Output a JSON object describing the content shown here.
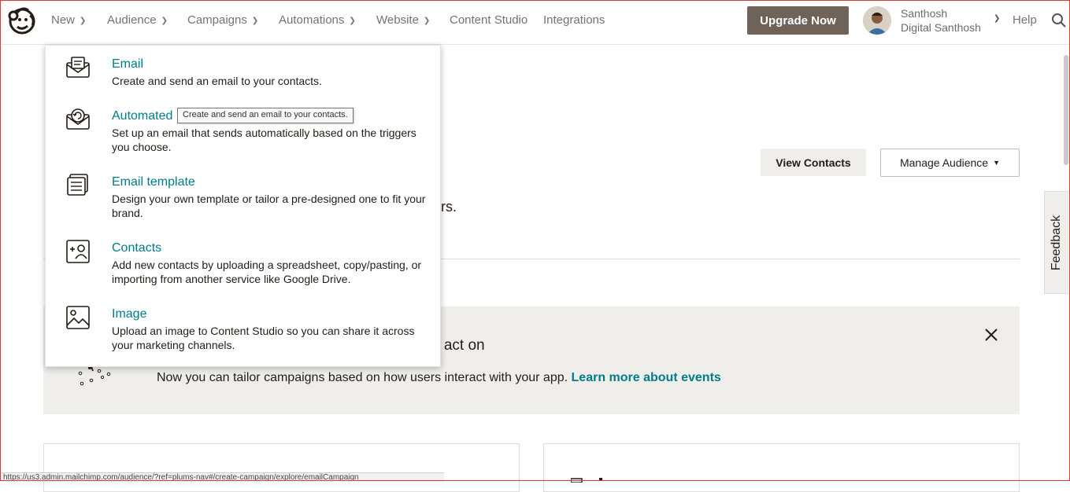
{
  "nav": {
    "items": [
      {
        "label": "New",
        "has_chevron": true
      },
      {
        "label": "Audience",
        "has_chevron": true
      },
      {
        "label": "Campaigns",
        "has_chevron": true
      },
      {
        "label": "Automations",
        "has_chevron": true
      },
      {
        "label": "Website",
        "has_chevron": true
      },
      {
        "label": "Content Studio",
        "has_chevron": false
      },
      {
        "label": "Integrations",
        "has_chevron": false
      }
    ],
    "upgrade_label": "Upgrade Now",
    "user_name": "Santhosh",
    "user_org": "Digital Santhosh",
    "help_label": "Help"
  },
  "dropdown": {
    "items": [
      {
        "title": "Email",
        "description": "Create and send an email to your contacts.",
        "icon": "envelope-icon"
      },
      {
        "title": "Automated",
        "description": "Set up an email that sends automatically based on the triggers you choose.",
        "icon": "automated-email-icon"
      },
      {
        "title": "Email template",
        "description": "Design your own template or tailor a pre-designed one to fit your brand.",
        "icon": "template-icon"
      },
      {
        "title": "Contacts",
        "description": "Add new contacts by uploading a spreadsheet, copy/pasting, or importing from another service like Google Drive.",
        "icon": "add-contact-icon"
      },
      {
        "title": "Image",
        "description": "Upload an image to Content Studio so you can share it across your marketing channels.",
        "icon": "image-icon"
      }
    ]
  },
  "tooltip": "Create and send an email to your contacts.",
  "page": {
    "view_contacts": "View Contacts",
    "manage_audience": "Manage Audience",
    "partial_text": "rs.",
    "banner_title": "n act on",
    "banner_body": "Now you can tailor campaigns based on how users interact with your app.",
    "banner_link": "Learn more about events",
    "feedback": "Feedback"
  },
  "status_url": "https://us3.admin.mailchimp.com/audience/?ref=plums-nav#/create-campaign/explore/emailCampaign",
  "colors": {
    "accent": "#007c89",
    "upgrade_bg": "#6e6259",
    "banner_bg": "#efeeea",
    "text": "#241c15"
  }
}
